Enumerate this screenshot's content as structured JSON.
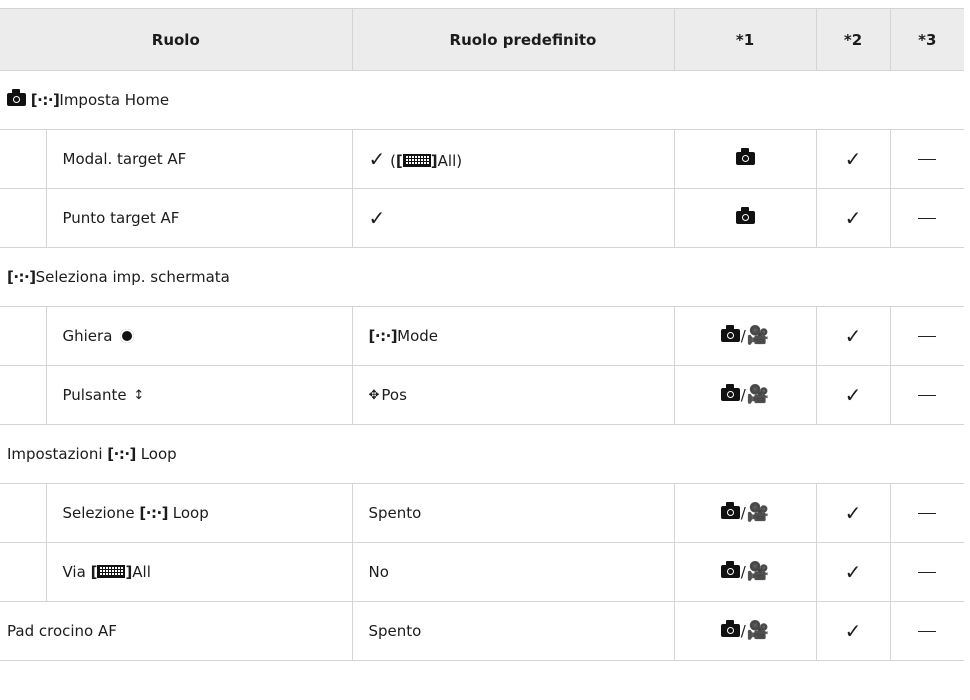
{
  "headers": {
    "role": "Ruolo",
    "default_role": "Ruolo predefinito",
    "col1": "*1",
    "col2": "*2",
    "col3": "*3"
  },
  "af_frame_glyph": "[·:·]",
  "groups": {
    "home": {
      "suffix": "Imposta Home"
    },
    "screen": {
      "suffix": "Seleziona imp. schermata"
    },
    "loop": {
      "prefix": "Impostazioni",
      "suffix": "Loop"
    }
  },
  "rows": {
    "af_mode": {
      "label": "Modal. target AF",
      "default_open": "(",
      "default_suffix": "All)"
    },
    "af_point": {
      "label": "Punto target AF"
    },
    "dial": {
      "label": "Ghiera",
      "default_suffix": "Mode"
    },
    "button": {
      "label": "Pulsante",
      "default_suffix": "Pos"
    },
    "loop_select": {
      "label_prefix": "Selezione",
      "label_suffix": "Loop",
      "default": "Spento"
    },
    "via_all": {
      "label_prefix": "Via",
      "label_suffix": "All",
      "default": "No"
    },
    "pad": {
      "label": "Pad crocino AF",
      "default": "Spento"
    }
  },
  "symbols": {
    "check": "✓",
    "slash": "/",
    "movie": "🎥",
    "arrows": "↕",
    "pos": "✥"
  },
  "icons": [
    "camera-icon",
    "movie-icon",
    "af-frame-icon",
    "af-all-grid-icon",
    "dial-icon",
    "arrow-pad-icon",
    "checkmark-icon",
    "dash-icon"
  ]
}
